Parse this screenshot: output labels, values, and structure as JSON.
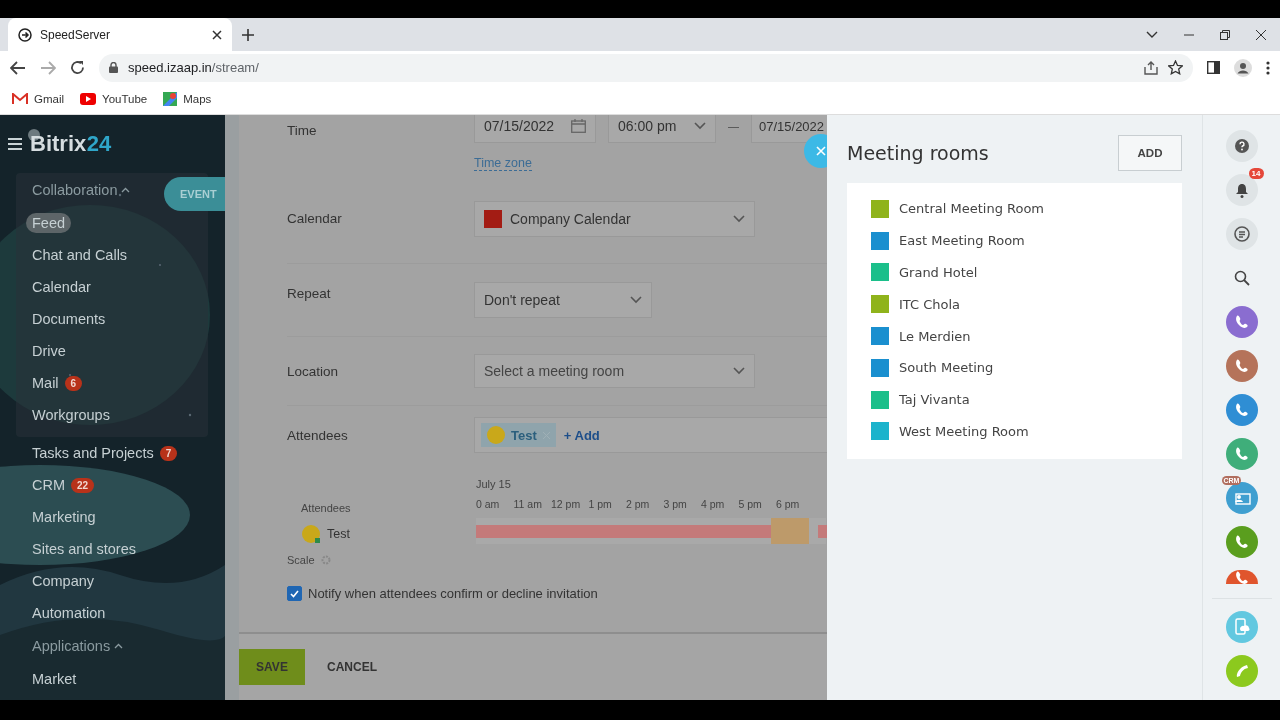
{
  "browser": {
    "tab": {
      "title": "SpeedServer"
    },
    "url": {
      "host": "speed.izaap.in",
      "path": "/stream/"
    },
    "bookmarks": [
      {
        "kind": "gmail",
        "label": "Gmail"
      },
      {
        "kind": "youtube",
        "label": "YouTube"
      },
      {
        "kind": "maps",
        "label": "Maps"
      }
    ]
  },
  "sidebar": {
    "logo": {
      "name": "Bitrix",
      "number": "24"
    },
    "event_button": "EVENT",
    "group": {
      "label": "Collaboration",
      "expanded": true,
      "items": [
        {
          "label": "Feed",
          "selected": true
        },
        {
          "label": "Chat and Calls",
          "selected": false
        },
        {
          "label": "Calendar",
          "selected": false
        },
        {
          "label": "Documents",
          "selected": false
        },
        {
          "label": "Drive",
          "selected": false
        },
        {
          "label": "Mail",
          "selected": false,
          "counter": "6"
        },
        {
          "label": "Workgroups",
          "selected": false
        }
      ]
    },
    "items": [
      {
        "label": "Tasks and Projects",
        "selected": false,
        "counter": "7"
      },
      {
        "label": "CRM",
        "selected": false,
        "counter": "22"
      },
      {
        "label": "Marketing",
        "selected": false
      },
      {
        "label": "Sites and stores",
        "selected": false
      },
      {
        "label": "Company",
        "selected": false
      },
      {
        "label": "Automation",
        "selected": false
      }
    ],
    "apps": {
      "label": "Applications",
      "expanded": true,
      "items": [
        {
          "label": "Market",
          "selected": false
        }
      ]
    }
  },
  "form": {
    "time": {
      "label": "Time",
      "from_date": "07/15/2022",
      "from_time": "06:00 pm",
      "separator": "—",
      "to_date": "07/15/2022",
      "time_zone": "Time zone"
    },
    "calendar": {
      "label": "Calendar",
      "value": "Company Calendar",
      "color": "#a31c14"
    },
    "repeat": {
      "label": "Repeat",
      "value": "Don't repeat"
    },
    "location": {
      "label": "Location",
      "placeholder": "Select a meeting room"
    },
    "attendees": {
      "label": "Attendees",
      "chips": [
        "Test"
      ],
      "add": "+ Add"
    },
    "planner": {
      "date": "July 15",
      "label": "Attendees",
      "hours": [
        "0 am",
        "11 am",
        "12 pm",
        "1 pm",
        "2 pm",
        "3 pm",
        "4 pm",
        "5 pm",
        "6 pm"
      ],
      "people": [
        "Test"
      ],
      "scale": "Scale"
    },
    "notify": {
      "label": "Notify when attendees confirm or decline invitation",
      "checked": true
    },
    "save": "SAVE",
    "cancel": "CANCEL"
  },
  "rooms_panel": {
    "title": "Meeting rooms",
    "add": "ADD",
    "rooms": [
      {
        "name": "Central Meeting Room",
        "color": "#8fb31b"
      },
      {
        "name": "East Meeting Room",
        "color": "#1a8fcf"
      },
      {
        "name": "Grand Hotel",
        "color": "#1bbf8a"
      },
      {
        "name": "ITC Chola",
        "color": "#8fb31b"
      },
      {
        "name": "Le Merdien",
        "color": "#1a8fcf"
      },
      {
        "name": "South Meeting",
        "color": "#1a8fcf"
      },
      {
        "name": "Taj Vivanta",
        "color": "#1bbf8a"
      },
      {
        "name": "West Meeting Room",
        "color": "#1bb3cc"
      }
    ]
  },
  "rail": [
    {
      "kind": "help"
    },
    {
      "kind": "bell",
      "badge": "14"
    },
    {
      "kind": "chat"
    },
    {
      "kind": "search"
    },
    {
      "kind": "call",
      "color": "#8a6dd0"
    },
    {
      "kind": "call",
      "color": "#b5735a"
    },
    {
      "kind": "call",
      "color": "#2f8ed4"
    },
    {
      "kind": "call",
      "color": "#3fae7a"
    },
    {
      "kind": "crm",
      "color": "#3f9fd0",
      "badge": "CRM"
    },
    {
      "kind": "call",
      "color": "#5a9e1e"
    },
    {
      "kind": "cut",
      "color": "#e0552d"
    },
    {
      "kind": "device",
      "color": "#62c8e0"
    },
    {
      "kind": "phone",
      "color": "#8cc91e"
    }
  ]
}
